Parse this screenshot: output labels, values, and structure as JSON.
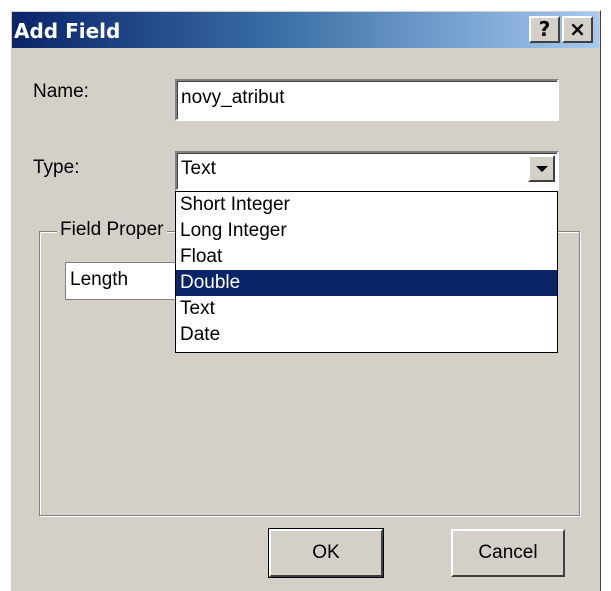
{
  "window": {
    "title": "Add Field",
    "help_button": "?",
    "close_button": "×"
  },
  "form": {
    "name_label": "Name:",
    "name_value": "novy_atribut",
    "type_label": "Type:",
    "type_value": "Text"
  },
  "type_options": [
    {
      "label": "Short Integer",
      "selected": false
    },
    {
      "label": "Long Integer",
      "selected": false
    },
    {
      "label": "Float",
      "selected": false
    },
    {
      "label": "Double",
      "selected": true
    },
    {
      "label": "Text",
      "selected": false
    },
    {
      "label": "Date",
      "selected": false
    }
  ],
  "field_properties": {
    "group_label": "Field Proper",
    "rows": [
      {
        "property": "Length"
      }
    ]
  },
  "buttons": {
    "ok": "OK",
    "cancel": "Cancel"
  },
  "colors": {
    "title_gradient_start": "#0a246a",
    "title_gradient_end": "#a6caf0",
    "dialog_face": "#d4d0c8",
    "selection": "#0a246a"
  }
}
